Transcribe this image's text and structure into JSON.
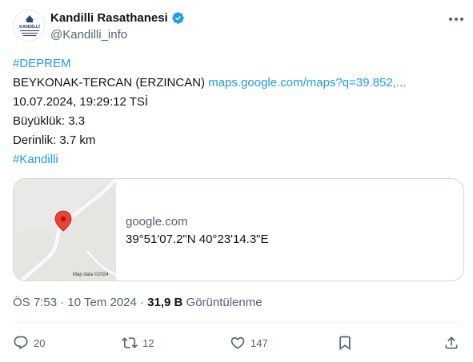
{
  "author": {
    "display_name": "Kandilli Rasathanesi",
    "handle": "@Kandilli_info",
    "avatar_text": "KANDİLLİ"
  },
  "post": {
    "hashtag_1": "#DEPREM",
    "location": "BEYKONAK-TERCAN (ERZINCAN)",
    "map_link": "maps.google.com/maps?q=39.852,...",
    "datetime": "10.07.2024, 19:29:12 TSİ",
    "magnitude": "Büyüklük: 3.3",
    "depth": "Derinlik: 3.7 km",
    "hashtag_2": "#Kandilli"
  },
  "card": {
    "domain": "google.com",
    "title": "39°51'07.2\"N 40°23'14.3\"E",
    "map_credit": "Map data ©2024"
  },
  "meta": {
    "time": "ÖS 7:53 · 10 Tem 2024 · ",
    "views_count": "31,9 B",
    "views_label": " Görüntülenme"
  },
  "actions": {
    "replies": "20",
    "reposts": "12",
    "likes": "147"
  },
  "colors": {
    "accent": "#1d9bf0",
    "secondary_text": "#536471",
    "map_pin": "#ea4335"
  },
  "icons": [
    "verified-badge-icon",
    "more-options-icon",
    "reply-icon",
    "repost-icon",
    "like-icon",
    "bookmark-icon",
    "share-icon",
    "map-pin-icon"
  ]
}
